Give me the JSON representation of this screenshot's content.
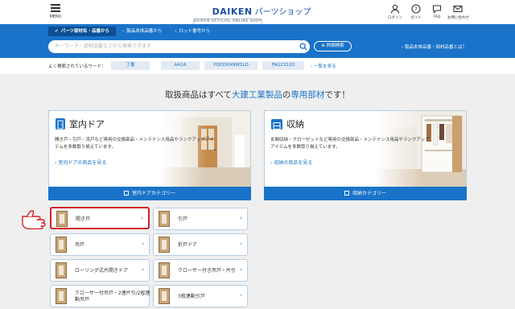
{
  "header": {
    "menu_label": "MENU",
    "brand": "DAIKEN",
    "site_name": "パーツショップ",
    "site_sub": "DAIKEN OFFICIAL ONLINE SHOP",
    "icons": [
      {
        "name": "login-icon",
        "label": "ログイン"
      },
      {
        "name": "guide-icon",
        "label": "ガイド"
      },
      {
        "name": "faq-icon",
        "label": "FAQ"
      },
      {
        "name": "contact-icon",
        "label": "お問い合わせ"
      }
    ]
  },
  "search": {
    "tabs": [
      "パーツ部材名・品番から",
      "製品本体品番から",
      "ロット番号から"
    ],
    "placeholder": "キーワード・部材品番などから検索できます",
    "advanced_label": "詳細検索",
    "help_link": "製品本体品番・部材品番とは？"
  },
  "frequent": {
    "label": "よく検索されているワード：",
    "chips": [
      "丁番",
      "AA1A",
      "PQDDK4NWSLD",
      "FAG21S1D"
    ],
    "more": "一覧を見る"
  },
  "headline": {
    "pre": "取扱商品はすべて",
    "brand": "大建工業製品",
    "mid": "の",
    "parts": "専用部材",
    "post": "です！"
  },
  "cards": [
    {
      "title": "室内ドア",
      "desc": "開き戸・引戸・吊戸など専用の交換部品・メンテナンス用品やランクアップアイテムを多数取り揃えています。",
      "link": "室内ドアの商品を見る",
      "category": "室内ドアカテゴリー"
    },
    {
      "title": "収納",
      "desc": "玄関収納・クローゼットなど専用の交換部品・メンテナンス用品やランクアップアイテムを多数取り揃えています。",
      "link": "収納の商品を見る",
      "category": "収納カテゴリー"
    }
  ],
  "subcategories": [
    "開き戸",
    "引戸",
    "吊戸",
    "折戸ドア",
    "ローリング式片開きドア",
    "クローザー付き吊戸・片引",
    "クローザー付吊戸・2連片引/2枚連動吊戸",
    "3枚連動引戸"
  ],
  "colors": {
    "accent": "#1a73c9",
    "dark_accent": "#0d4e94",
    "highlight": "#d3202a"
  }
}
